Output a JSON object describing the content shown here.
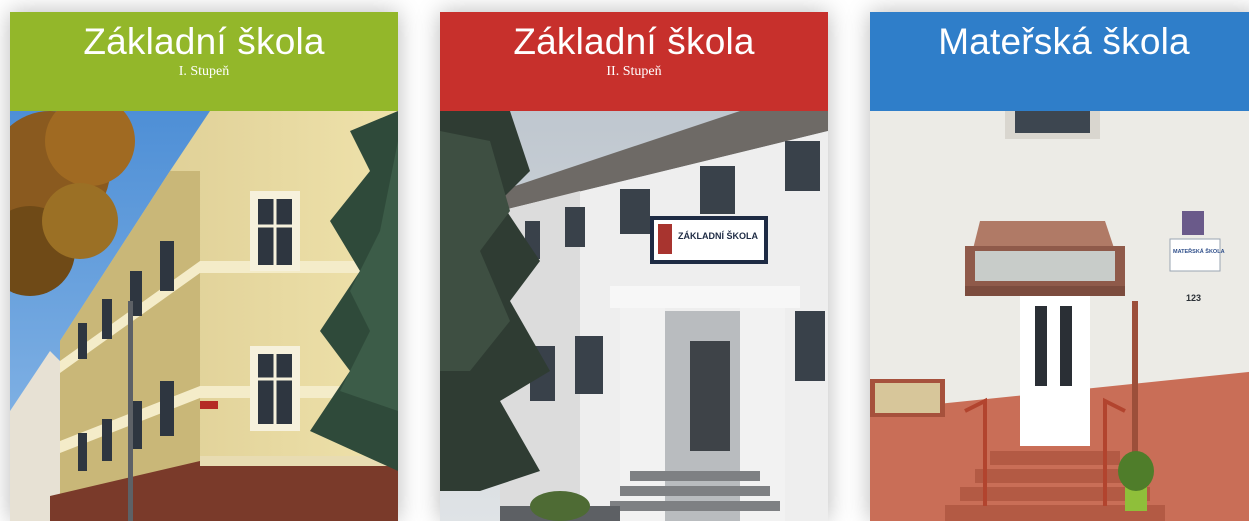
{
  "cards": [
    {
      "title": "Základní škola",
      "subtitle": "I. Stupeň",
      "color": "#93b72a",
      "building_sign": ""
    },
    {
      "title": "Základní škola",
      "subtitle": "II. Stupeň",
      "color": "#c7302c",
      "building_sign": "ZÁKLADNÍ ŠKOLA"
    },
    {
      "title": "Mateřská škola",
      "subtitle": "",
      "color": "#2f7ec9",
      "building_sign": "MATEŘSKÁ ŠKOLA",
      "house_number": "123"
    }
  ]
}
